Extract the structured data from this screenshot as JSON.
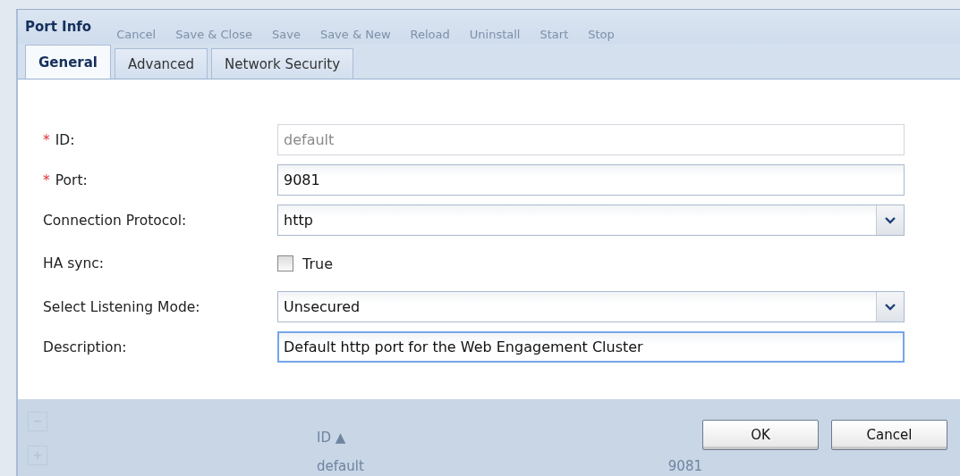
{
  "window": {
    "title": "Port Info"
  },
  "background_toolbar": [
    "Cancel",
    "Save & Close",
    "Save",
    "Save & New",
    "Reload",
    "Uninstall",
    "Start",
    "Stop"
  ],
  "tabs": [
    {
      "label": "General",
      "selected": true
    },
    {
      "label": "Advanced",
      "selected": false
    },
    {
      "label": "Network Security",
      "selected": false
    }
  ],
  "fields": [
    {
      "kind": "text",
      "required_mark": "*",
      "label": "ID:",
      "disabled": true,
      "focused": false,
      "value": "default"
    },
    {
      "kind": "text",
      "required_mark": "*",
      "label": "Port:",
      "disabled": false,
      "focused": false,
      "value": "9081"
    },
    {
      "kind": "combo",
      "label": "Connection Protocol:",
      "value": "http"
    },
    {
      "kind": "checkbox",
      "label": "HA sync:",
      "checked": false,
      "value": "True"
    },
    {
      "kind": "combo",
      "label": "Select Listening Mode:",
      "value": "Unsecured"
    },
    {
      "kind": "text",
      "label": "Description:",
      "disabled": false,
      "focused": true,
      "value": "Default http port for the Web Engagement Cluster"
    }
  ],
  "background_grid": {
    "column": "ID ▲",
    "cells": [
      "default",
      "9081"
    ]
  },
  "buttons": [
    "OK",
    "Cancel"
  ]
}
